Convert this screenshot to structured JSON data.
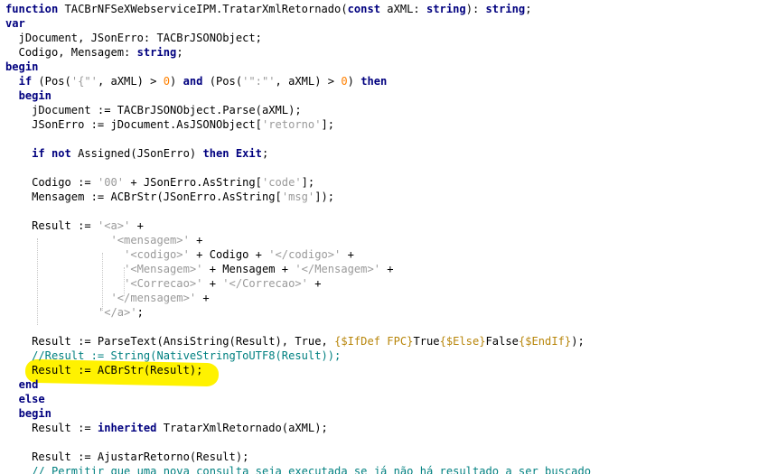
{
  "editor": {
    "language": "Delphi / Object Pascal",
    "colors": {
      "keyword": "#00007f",
      "string": "#9a9a9a",
      "number": "#ff8000",
      "directive": "#b8860b",
      "comment": "#008080",
      "highlight": "#fff200"
    },
    "lines": [
      [
        {
          "t": "function",
          "c": "kw"
        },
        {
          "t": " TACBrNFSeXWebserviceIPM.TratarXmlRetornado("
        },
        {
          "t": "const",
          "c": "kw"
        },
        {
          "t": " aXML: "
        },
        {
          "t": "string",
          "c": "kw"
        },
        {
          "t": "): "
        },
        {
          "t": "string",
          "c": "kw"
        },
        {
          "t": ";"
        }
      ],
      [
        {
          "t": "var",
          "c": "kw"
        }
      ],
      [
        {
          "t": "  jDocument, JSonErro: TACBrJSONObject;"
        }
      ],
      [
        {
          "t": "  Codigo, Mensagem: "
        },
        {
          "t": "string",
          "c": "kw"
        },
        {
          "t": ";"
        }
      ],
      [
        {
          "t": "begin",
          "c": "kw"
        }
      ],
      [
        {
          "t": "  "
        },
        {
          "t": "if",
          "c": "kw"
        },
        {
          "t": " (Pos("
        },
        {
          "t": "'{\"'",
          "c": "str"
        },
        {
          "t": ", aXML) > "
        },
        {
          "t": "0",
          "c": "num"
        },
        {
          "t": ") "
        },
        {
          "t": "and",
          "c": "kw"
        },
        {
          "t": " (Pos("
        },
        {
          "t": "'\":\"'",
          "c": "str"
        },
        {
          "t": ", aXML) > "
        },
        {
          "t": "0",
          "c": "num"
        },
        {
          "t": ") "
        },
        {
          "t": "then",
          "c": "kw"
        }
      ],
      [
        {
          "t": "  "
        },
        {
          "t": "begin",
          "c": "kw"
        }
      ],
      [
        {
          "t": "    jDocument := TACBrJSONObject.Parse(aXML);"
        }
      ],
      [
        {
          "t": "    JSonErro := jDocument.AsJSONObject["
        },
        {
          "t": "'retorno'",
          "c": "str"
        },
        {
          "t": "];"
        }
      ],
      [],
      [
        {
          "t": "    "
        },
        {
          "t": "if",
          "c": "kw"
        },
        {
          "t": " "
        },
        {
          "t": "not",
          "c": "kw"
        },
        {
          "t": " Assigned(JSonErro) "
        },
        {
          "t": "then",
          "c": "kw"
        },
        {
          "t": " "
        },
        {
          "t": "Exit",
          "c": "kw"
        },
        {
          "t": ";"
        }
      ],
      [],
      [
        {
          "t": "    Codigo := "
        },
        {
          "t": "'00'",
          "c": "str"
        },
        {
          "t": " + JSonErro.AsString["
        },
        {
          "t": "'code'",
          "c": "str"
        },
        {
          "t": "];"
        }
      ],
      [
        {
          "t": "    Mensagem := ACBrStr(JSonErro.AsString["
        },
        {
          "t": "'msg'",
          "c": "str"
        },
        {
          "t": "]);"
        }
      ],
      [],
      [
        {
          "t": "    Result := "
        },
        {
          "t": "'<a>'",
          "c": "str"
        },
        {
          "t": " +"
        }
      ],
      [
        {
          "t": "                "
        },
        {
          "t": "'<mensagem>'",
          "c": "str"
        },
        {
          "t": " +"
        }
      ],
      [
        {
          "t": "                  "
        },
        {
          "t": "'<codigo>'",
          "c": "str"
        },
        {
          "t": " + Codigo + "
        },
        {
          "t": "'</codigo>'",
          "c": "str"
        },
        {
          "t": " +"
        }
      ],
      [
        {
          "t": "                  "
        },
        {
          "t": "'<Mensagem>'",
          "c": "str"
        },
        {
          "t": " + Mensagem + "
        },
        {
          "t": "'</Mensagem>'",
          "c": "str"
        },
        {
          "t": " +"
        }
      ],
      [
        {
          "t": "                  "
        },
        {
          "t": "'<Correcao>'",
          "c": "str"
        },
        {
          "t": " + "
        },
        {
          "t": "'</Correcao>'",
          "c": "str"
        },
        {
          "t": " +"
        }
      ],
      [
        {
          "t": "                "
        },
        {
          "t": "'</mensagem>'",
          "c": "str"
        },
        {
          "t": " +"
        }
      ],
      [
        {
          "t": "              "
        },
        {
          "t": "'</a>'",
          "c": "str"
        },
        {
          "t": ";"
        }
      ],
      [],
      [
        {
          "t": "    Result := ParseText(AnsiString(Result), True, "
        },
        {
          "t": "{$IfDef FPC}",
          "c": "dir"
        },
        {
          "t": "True"
        },
        {
          "t": "{$Else}",
          "c": "dir"
        },
        {
          "t": "False"
        },
        {
          "t": "{$EndIf}",
          "c": "dir"
        },
        {
          "t": ");"
        }
      ],
      [
        {
          "t": "    "
        },
        {
          "t": "//Result := String(NativeStringToUTF8(Result));",
          "c": "cmt"
        }
      ],
      [
        {
          "t": "    Result := ACBrStr(Result);"
        }
      ],
      [
        {
          "t": "  "
        },
        {
          "t": "end",
          "c": "kw"
        }
      ],
      [
        {
          "t": "  "
        },
        {
          "t": "else",
          "c": "kw"
        }
      ],
      [
        {
          "t": "  "
        },
        {
          "t": "begin",
          "c": "kw"
        }
      ],
      [
        {
          "t": "    Result := "
        },
        {
          "t": "inherited",
          "c": "kw"
        },
        {
          "t": " TratarXmlRetornado(aXML);"
        }
      ],
      [],
      [
        {
          "t": "    Result := AjustarRetorno(Result);"
        }
      ],
      [
        {
          "t": "    "
        },
        {
          "t": "// Permitir que uma nova consulta seja executada se já não há resultado a ser buscado",
          "c": "cmt"
        }
      ]
    ]
  }
}
